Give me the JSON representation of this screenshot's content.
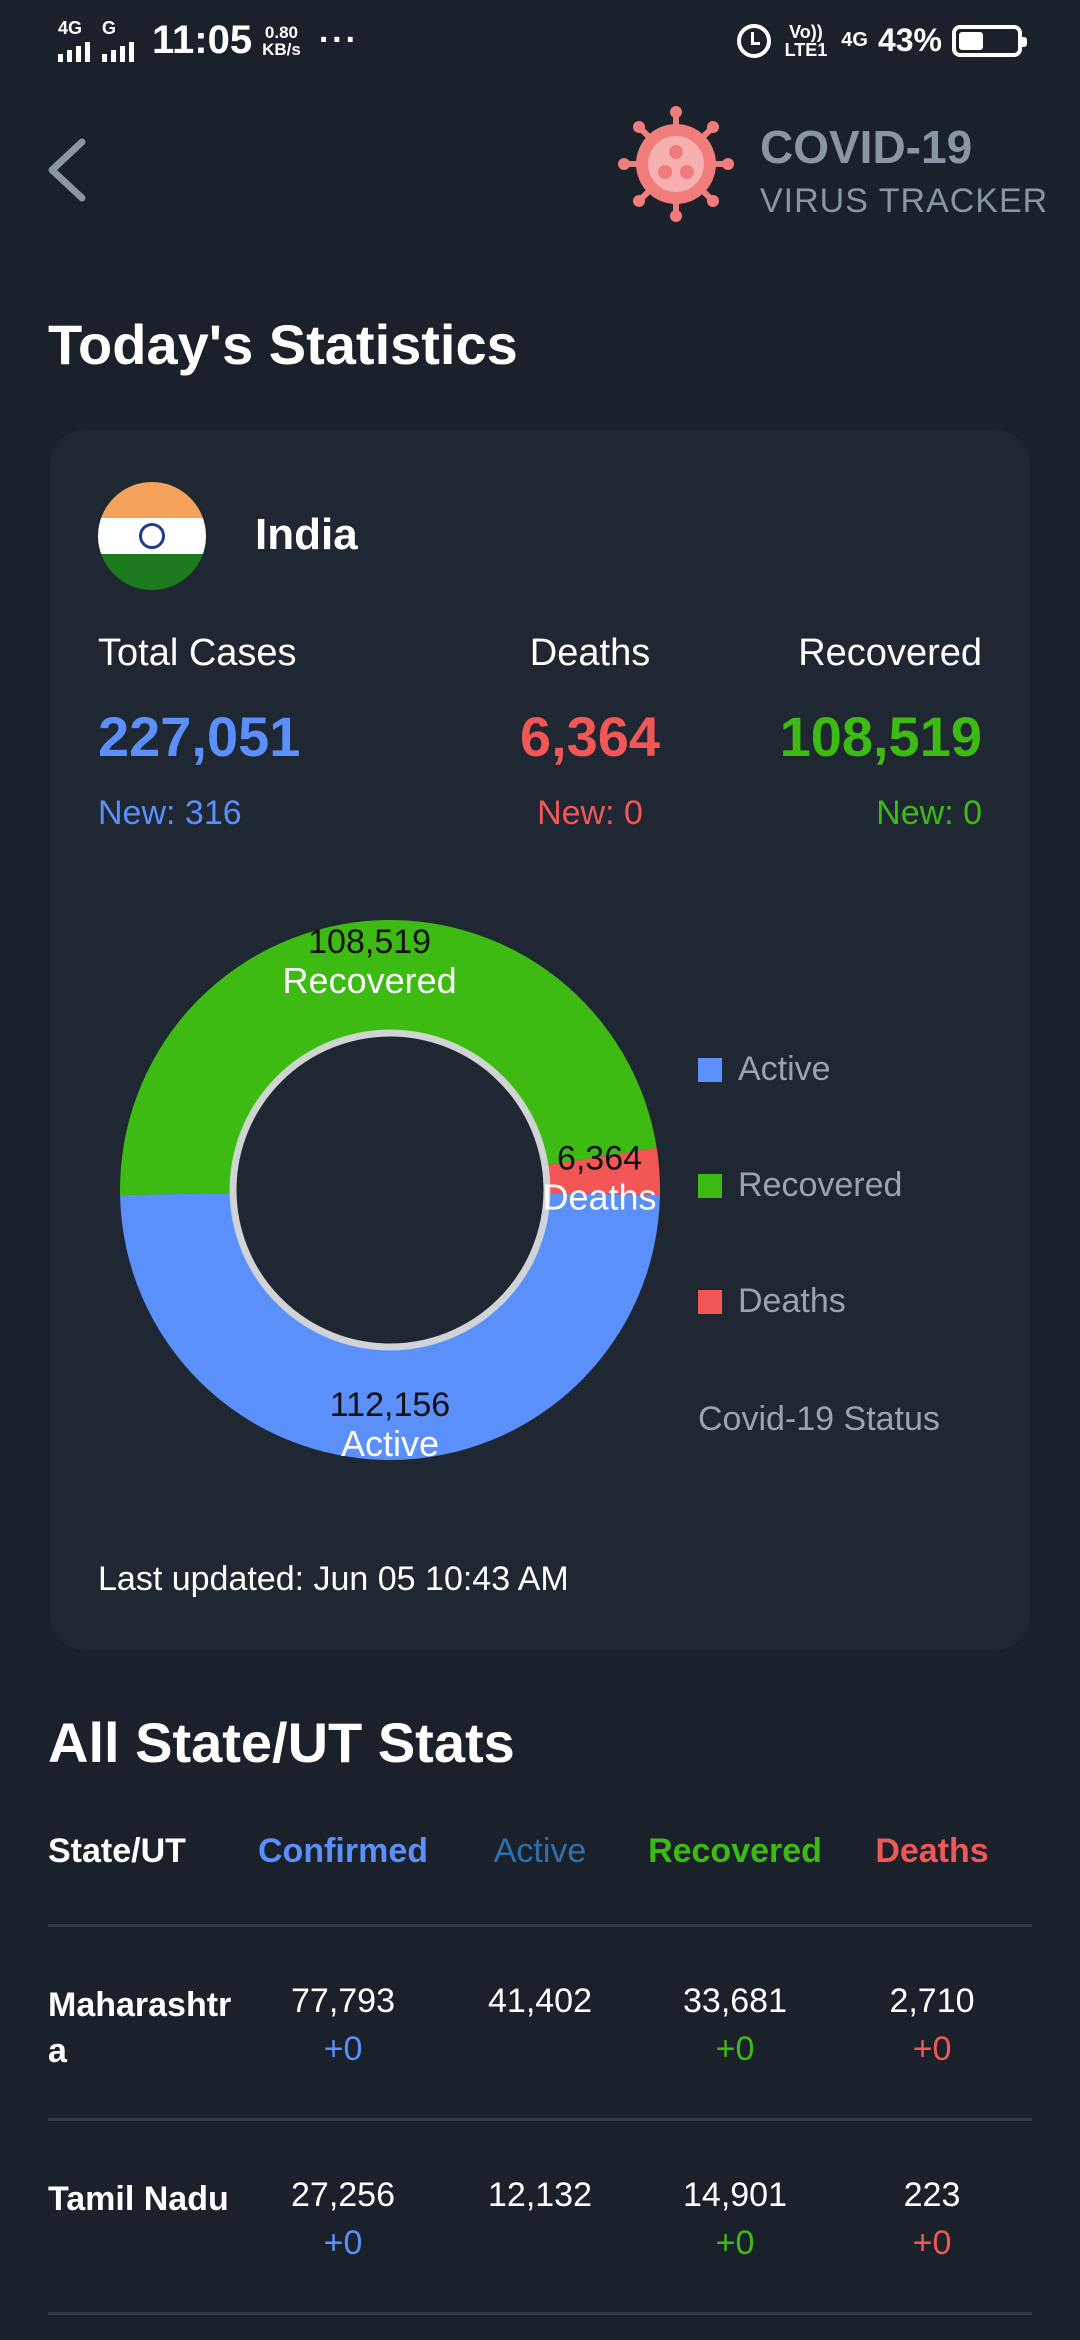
{
  "status_bar": {
    "net1": "4G",
    "net2": "G",
    "time": "11:05",
    "speed_value": "0.80",
    "speed_unit": "KB/s",
    "more": "···",
    "volte_top": "Vo))",
    "volte_bottom": "LTE1",
    "net3": "4G",
    "battery_percent": "43%",
    "battery_level": 0.43
  },
  "header": {
    "title": "COVID-19",
    "subtitle": "VIRUS TRACKER",
    "back_icon": "chevron-left-icon",
    "logo_icon": "virus-icon"
  },
  "todays_stats": {
    "title": "Today's Statistics",
    "country": "India",
    "flag_icon": "india-flag-icon",
    "total": {
      "label": "Total Cases",
      "value": "227,051",
      "new": "New: 316"
    },
    "deaths": {
      "label": "Deaths",
      "value": "6,364",
      "new": "New: 0"
    },
    "recovered": {
      "label": "Recovered",
      "value": "108,519",
      "new": "New: 0"
    },
    "last_updated": "Last updated: Jun 05 10:43 AM"
  },
  "chart_data": {
    "type": "pie",
    "series": [
      {
        "name": "Active",
        "value": 112156,
        "label_value": "112,156",
        "color": "#5b8ff9"
      },
      {
        "name": "Recovered",
        "value": 108519,
        "label_value": "108,519",
        "color": "#3dbb13"
      },
      {
        "name": "Deaths",
        "value": 6364,
        "label_value": "6,364",
        "color": "#f25757"
      }
    ],
    "legend": [
      "Active",
      "Recovered",
      "Deaths"
    ],
    "legend_placement": "right",
    "caption": "Covid-19 Status"
  },
  "state_stats": {
    "title": "All State/UT Stats",
    "columns": [
      "State/UT",
      "Confirmed",
      "Active",
      "Recovered",
      "Deaths"
    ],
    "column_colors": [
      "#ffffff",
      "#5b8ff9",
      "#2f6fae",
      "#3dbb13",
      "#f25757"
    ],
    "rows": [
      {
        "state_line1": "Maharashtr",
        "state_line2": "a",
        "confirmed": "77,793",
        "confirmed_delta": "+0",
        "active": "41,402",
        "recovered": "33,681",
        "recovered_delta": "+0",
        "deaths": "2,710",
        "deaths_delta": "+0"
      },
      {
        "state_line1": "Tamil Nadu",
        "state_line2": "",
        "confirmed": "27,256",
        "confirmed_delta": "+0",
        "active": "12,132",
        "recovered": "14,901",
        "recovered_delta": "+0",
        "deaths": "223",
        "deaths_delta": "+0"
      }
    ]
  }
}
